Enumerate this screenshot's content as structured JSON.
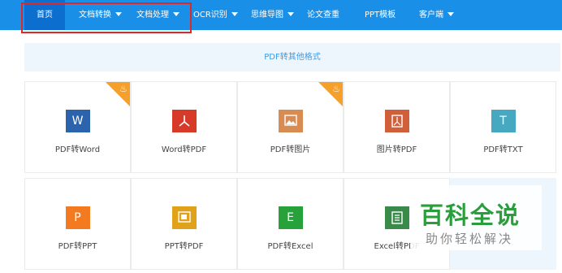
{
  "nav": {
    "items": [
      {
        "label": "首页",
        "dropdown": false,
        "active": true
      },
      {
        "label": "文档转换",
        "dropdown": true
      },
      {
        "label": "文档处理",
        "dropdown": true
      },
      {
        "label": "OCR识别",
        "dropdown": true
      },
      {
        "label": "思维导图",
        "dropdown": true
      },
      {
        "label": "论文查重",
        "dropdown": false
      },
      {
        "label": "PPT模板",
        "dropdown": false
      },
      {
        "label": "客户端",
        "dropdown": true
      }
    ]
  },
  "subheader": {
    "title": "PDF转其他格式"
  },
  "tools": [
    {
      "label": "PDF转Word",
      "icon": "word-icon",
      "glyph": "W",
      "color": "#2b64ad",
      "hot": true
    },
    {
      "label": "Word转PDF",
      "icon": "pdf-icon",
      "glyph": "",
      "color": "#d83a2a",
      "hot": false
    },
    {
      "label": "PDF转图片",
      "icon": "image-icon",
      "glyph": "",
      "color": "#d98c52",
      "hot": true
    },
    {
      "label": "图片转PDF",
      "icon": "pdf-doc-icon",
      "glyph": "",
      "color": "#d0603a",
      "hot": false
    },
    {
      "label": "PDF转TXT",
      "icon": "txt-icon",
      "glyph": "T",
      "color": "#47a9c1",
      "hot": false
    },
    {
      "label": "PDF转PPT",
      "icon": "ppt-icon",
      "glyph": "P",
      "color": "#f47a1f",
      "hot": false
    },
    {
      "label": "PPT转PDF",
      "icon": "slide-icon",
      "glyph": "",
      "color": "#e0a11b",
      "hot": false
    },
    {
      "label": "PDF转Excel",
      "icon": "excel-icon",
      "glyph": "E",
      "color": "#27a13a",
      "hot": false
    },
    {
      "label": "Excel转PDF",
      "icon": "excel-pdf-icon",
      "glyph": "",
      "color": "#3a8a4a",
      "hot": false
    }
  ],
  "watermark": {
    "title": "百科全说",
    "subtitle": "助你轻松解决"
  }
}
